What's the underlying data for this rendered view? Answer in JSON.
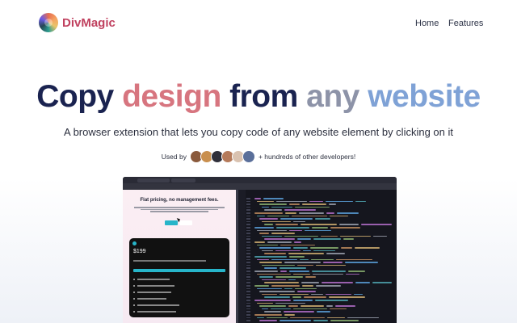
{
  "nav": {
    "brand": "DivMagic",
    "home": "Home",
    "features": "Features"
  },
  "hero": {
    "word1": "Copy",
    "word2": "design",
    "word3": "from",
    "word4": "any",
    "word5": "website",
    "subtitle": "A browser extension that lets you copy code of any website element by clicking on it"
  },
  "social": {
    "used_by": "Used by",
    "developers": "+ hundreds of other developers!",
    "avatar_colors": [
      "#8a5a3c",
      "#c98f4e",
      "#2f2f3a",
      "#b57a5a",
      "#d9c2b0",
      "#5a6f9a"
    ]
  },
  "preview": {
    "pricing_title": "Flat pricing, no management fees.",
    "price": "$199"
  },
  "colors": {
    "brand": "#c0415f",
    "navy": "#1a2350",
    "pink": "#d7757f",
    "gray": "#8d93a8",
    "blue": "#7fa2d6",
    "teal": "#27b5c9"
  }
}
